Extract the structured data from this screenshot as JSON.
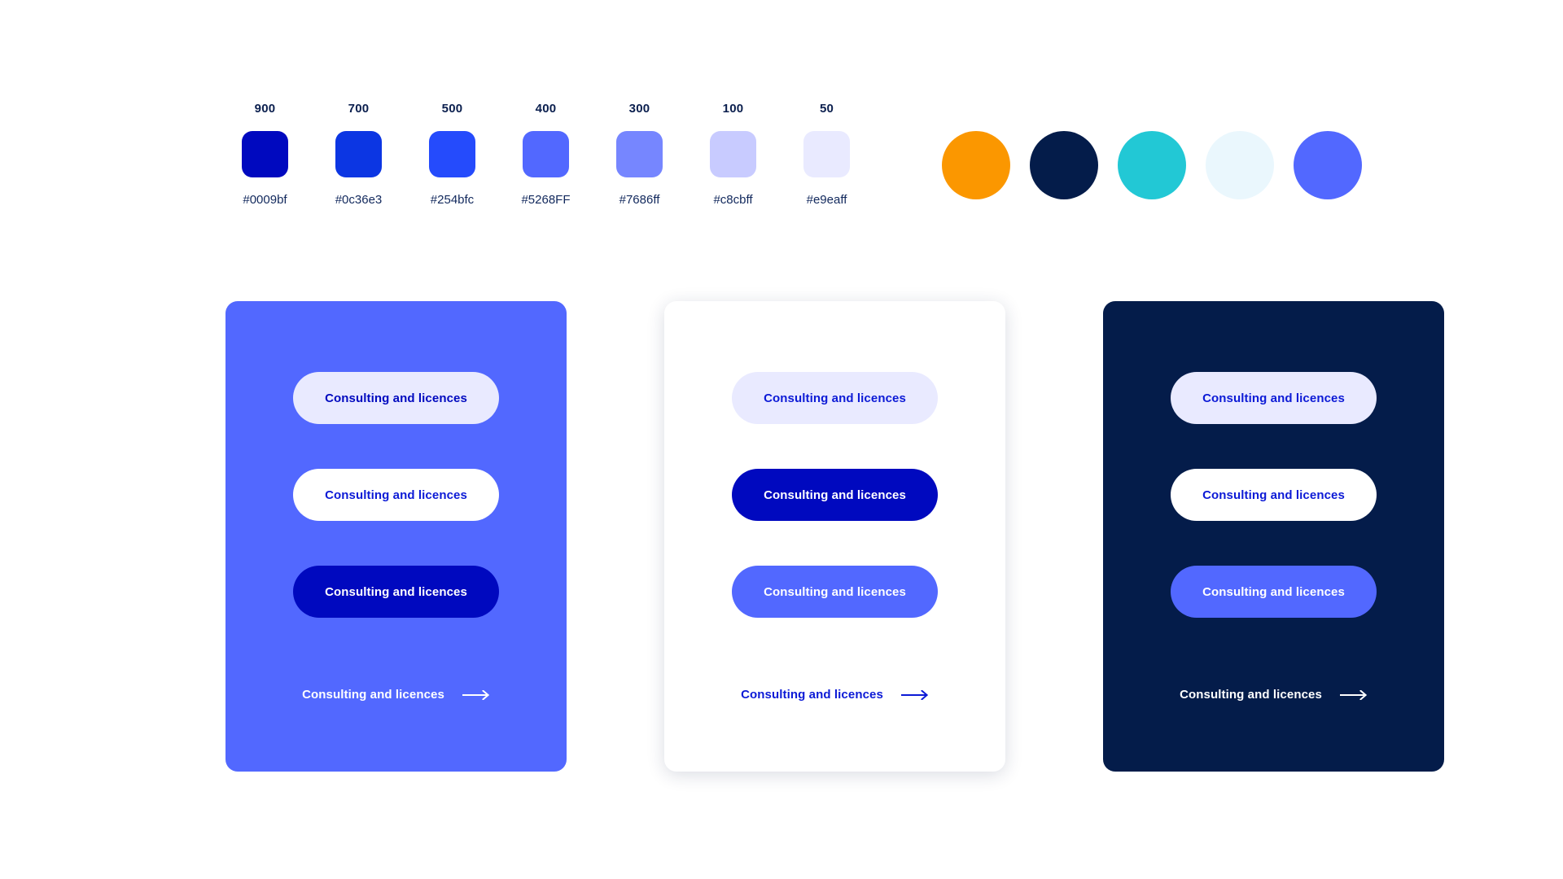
{
  "palette": {
    "swatches": [
      {
        "level": "900",
        "hex": "#0009bf"
      },
      {
        "level": "700",
        "hex": "#0c36e3"
      },
      {
        "level": "500",
        "hex": "#254bfc"
      },
      {
        "level": "400",
        "hex": "#5268FF"
      },
      {
        "level": "300",
        "hex": "#7686ff"
      },
      {
        "level": "100",
        "hex": "#c8cbff"
      },
      {
        "level": "50",
        "hex": "#e9eaff"
      }
    ],
    "accent_circles": [
      {
        "name": "accent-orange",
        "hex": "#fb9700"
      },
      {
        "name": "accent-navy",
        "hex": "#041c4a"
      },
      {
        "name": "accent-teal",
        "hex": "#22c8d5"
      },
      {
        "name": "accent-pale-blue",
        "hex": "#eaf7fd"
      },
      {
        "name": "accent-periwinkle",
        "hex": "#5268ff"
      }
    ]
  },
  "cards": [
    {
      "name": "periwinkle",
      "background": "#5268ff",
      "shadow": false,
      "buttons": [
        {
          "label": "Consulting and licences",
          "background": "#e9eaff",
          "color": "#0009bf"
        },
        {
          "label": "Consulting and licences",
          "background": "#ffffff",
          "color": "#0c1ad6"
        },
        {
          "label": "Consulting and licences",
          "background": "#0009bf",
          "color": "#ffffff"
        }
      ],
      "link": {
        "label": "Consulting and licences",
        "color": "#ffffff",
        "icon": "arrow-right-icon"
      }
    },
    {
      "name": "white",
      "background": "#ffffff",
      "shadow": true,
      "buttons": [
        {
          "label": "Consulting and licences",
          "background": "#e9eaff",
          "color": "#0c1ad6"
        },
        {
          "label": "Consulting and licences",
          "background": "#0009bf",
          "color": "#ffffff"
        },
        {
          "label": "Consulting and licences",
          "background": "#5268ff",
          "color": "#ffffff"
        }
      ],
      "link": {
        "label": "Consulting and licences",
        "color": "#0c1ad6",
        "icon": "arrow-right-icon"
      }
    },
    {
      "name": "navy",
      "background": "#041c4a",
      "shadow": false,
      "buttons": [
        {
          "label": "Consulting and licences",
          "background": "#e9eaff",
          "color": "#0c1ad6"
        },
        {
          "label": "Consulting and licences",
          "background": "#ffffff",
          "color": "#0c1ad6"
        },
        {
          "label": "Consulting and licences",
          "background": "#5268ff",
          "color": "#ffffff"
        }
      ],
      "link": {
        "label": "Consulting and licences",
        "color": "#ffffff",
        "icon": "arrow-right-icon"
      }
    }
  ]
}
